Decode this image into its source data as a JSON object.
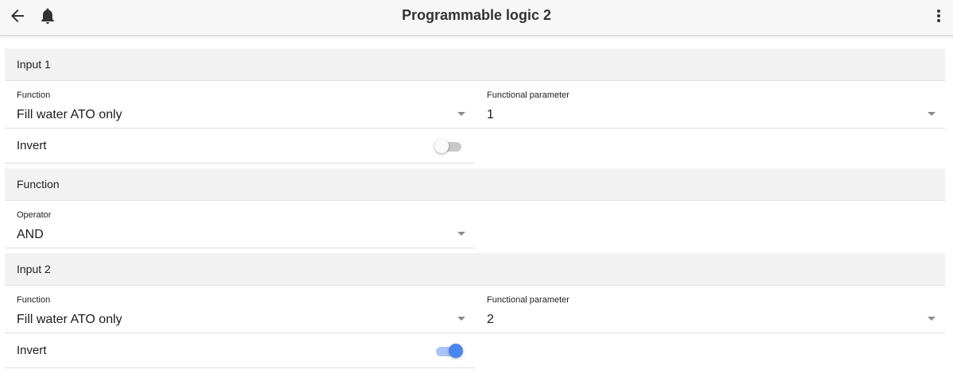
{
  "header": {
    "title": "Programmable logic 2",
    "back_icon": "arrow-back-icon",
    "bell_icon": "bell-icon",
    "more_icon": "more-vert-icon"
  },
  "input1": {
    "title": "Input 1",
    "function_label": "Function",
    "function_value": "Fill water ATO only",
    "param_label": "Functional parameter",
    "param_value": "1",
    "invert_label": "Invert",
    "invert_on": false
  },
  "function_section": {
    "title": "Function",
    "operator_label": "Operator",
    "operator_value": "AND"
  },
  "input2": {
    "title": "Input 2",
    "function_label": "Function",
    "function_value": "Fill water ATO only",
    "param_label": "Functional parameter",
    "param_value": "2",
    "invert_label": "Invert",
    "invert_on": true
  },
  "colors": {
    "toggle_on": "#4b86f0",
    "toggle_off": "#fafafa",
    "section_bg": "#f2f2f2"
  }
}
